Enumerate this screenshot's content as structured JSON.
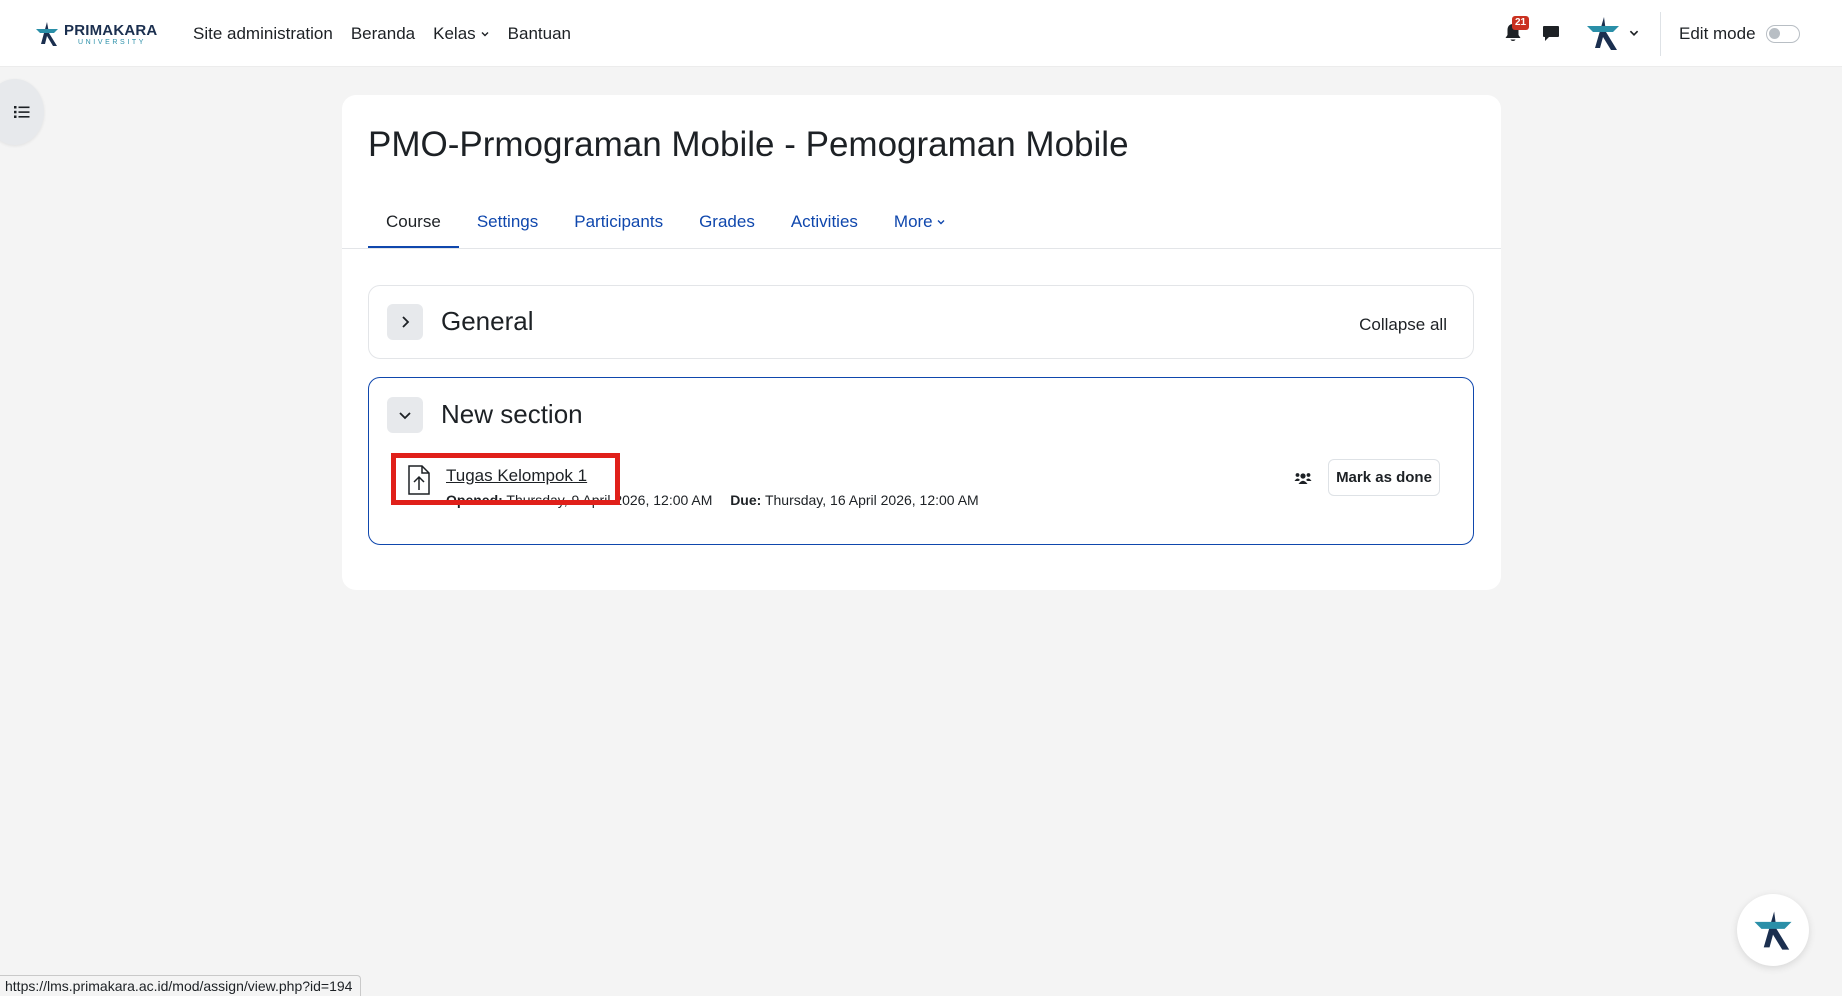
{
  "navbar": {
    "logo": {
      "main": "PRIMAKARA",
      "sub": "UNIVERSITY"
    },
    "links": [
      "Site administration",
      "Beranda",
      "Kelas",
      "Bantuan"
    ],
    "notification_count": "21",
    "edit_mode_label": "Edit mode"
  },
  "course": {
    "title": "PMO-Prmograman Mobile - Pemograman Mobile",
    "tabs": [
      "Course",
      "Settings",
      "Participants",
      "Grades",
      "Activities",
      "More"
    ],
    "active_tab": "Course"
  },
  "sections": {
    "general": {
      "title": "General",
      "collapse_all": "Collapse all"
    },
    "new_section": {
      "title": "New section",
      "activity": {
        "name": "Tugas Kelompok 1",
        "opened_label": "Opened:",
        "opened_value": "Thursday, 9 April 2026, 12:00 AM",
        "due_label": "Due:",
        "due_value": "Thursday, 16 April 2026, 12:00 AM",
        "mark_done": "Mark as done"
      }
    }
  },
  "status_url": "https://lms.primakara.ac.id/mod/assign/view.php?id=194",
  "colors": {
    "link": "#0f47ad",
    "highlight": "#e0201a",
    "badge": "#ca3120"
  }
}
